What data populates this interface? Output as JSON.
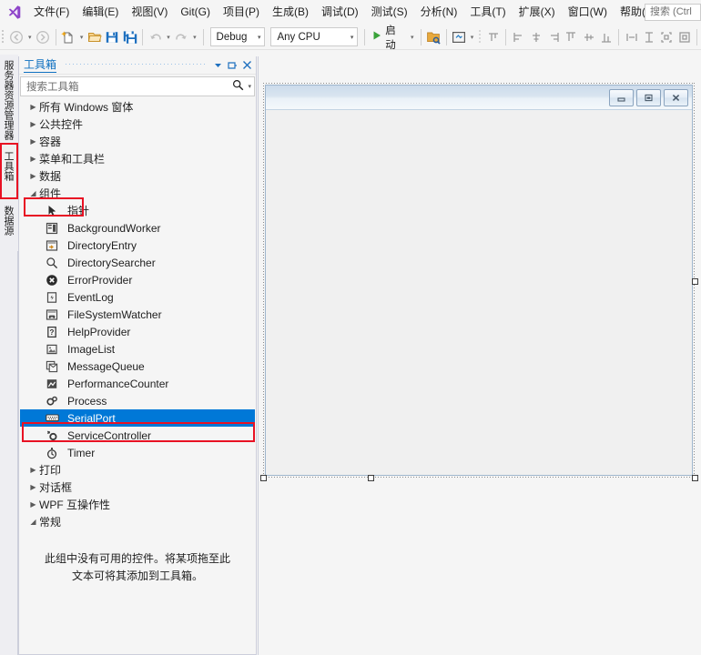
{
  "app": {
    "logo_icon": "visual-studio-logo",
    "menu": [
      {
        "label": "文件(F)",
        "name": "menu-file"
      },
      {
        "label": "编辑(E)",
        "name": "menu-edit"
      },
      {
        "label": "视图(V)",
        "name": "menu-view"
      },
      {
        "label": "Git(G)",
        "name": "menu-git"
      },
      {
        "label": "项目(P)",
        "name": "menu-project"
      },
      {
        "label": "生成(B)",
        "name": "menu-build"
      },
      {
        "label": "调试(D)",
        "name": "menu-debug"
      },
      {
        "label": "测试(S)",
        "name": "menu-test"
      },
      {
        "label": "分析(N)",
        "name": "menu-analyze"
      },
      {
        "label": "工具(T)",
        "name": "menu-tools"
      },
      {
        "label": "扩展(X)",
        "name": "menu-extensions"
      },
      {
        "label": "窗口(W)",
        "name": "menu-window"
      },
      {
        "label": "帮助(H)",
        "name": "menu-help"
      }
    ],
    "search": {
      "placeholder": "搜索 (Ctrl",
      "value": ""
    }
  },
  "toolbar": {
    "nav_back_icon": "back-arrow-icon",
    "nav_forward_icon": "forward-arrow-icon",
    "new_file_icon": "new-file-icon",
    "open_file_icon": "open-folder-icon",
    "save_icon": "save-icon",
    "save_all_icon": "save-all-icon",
    "undo_icon": "undo-icon",
    "redo_icon": "redo-icon",
    "configuration": {
      "value": "Debug",
      "caret": "▾"
    },
    "platform": {
      "value": "Any CPU",
      "caret": "▾"
    },
    "run": {
      "label": "启动",
      "play_icon": "play-triangle-icon",
      "caret": "▾"
    },
    "align_icons": [
      "find-in-files-icon",
      "preview-icon",
      "dropdown-small-icon",
      "align-tops-icon",
      "align-lefts-icon",
      "align-centers-icon",
      "align-rights-icon",
      "align-top-edges-icon",
      "align-middles-icon",
      "align-bottoms-icon",
      "make-same-width-icon",
      "make-same-height-icon",
      "size-to-grid-icon",
      "center-horizontally-icon"
    ]
  },
  "vertical_tabs": [
    {
      "label": "服务器资源管理器",
      "name": "vtab-server-explorer",
      "active": false,
      "highlighted": false
    },
    {
      "label": "工具箱",
      "name": "vtab-toolbox",
      "active": true,
      "highlighted": true
    },
    {
      "label": "数据源",
      "name": "vtab-data-sources",
      "active": false,
      "highlighted": false
    }
  ],
  "toolbox": {
    "title": "工具箱",
    "dropdown_icon": "chevron-down-icon",
    "pin_icon": "pin-icon",
    "close_icon": "close-icon",
    "search": {
      "placeholder": "搜索工具箱",
      "value": "",
      "icon": "search-icon",
      "caret": "▾"
    },
    "groups": [
      {
        "label": "所有 Windows 窗体",
        "expanded": false,
        "name": "toolbox-group-all-windows-forms"
      },
      {
        "label": "公共控件",
        "expanded": false,
        "name": "toolbox-group-common-controls"
      },
      {
        "label": "容器",
        "expanded": false,
        "name": "toolbox-group-containers"
      },
      {
        "label": "菜单和工具栏",
        "expanded": false,
        "name": "toolbox-group-menus-toolbars"
      },
      {
        "label": "数据",
        "expanded": false,
        "name": "toolbox-group-data"
      },
      {
        "label": "组件",
        "expanded": true,
        "name": "toolbox-group-components",
        "highlighted": true
      }
    ],
    "components": [
      {
        "label": "指针",
        "icon": "pointer-icon",
        "selected": false
      },
      {
        "label": "BackgroundWorker",
        "icon": "background-worker-icon",
        "selected": false
      },
      {
        "label": "DirectoryEntry",
        "icon": "directory-entry-icon",
        "selected": false
      },
      {
        "label": "DirectorySearcher",
        "icon": "directory-searcher-icon",
        "selected": false
      },
      {
        "label": "ErrorProvider",
        "icon": "error-provider-icon",
        "selected": false
      },
      {
        "label": "EventLog",
        "icon": "event-log-icon",
        "selected": false
      },
      {
        "label": "FileSystemWatcher",
        "icon": "file-system-watcher-icon",
        "selected": false
      },
      {
        "label": "HelpProvider",
        "icon": "help-provider-icon",
        "selected": false
      },
      {
        "label": "ImageList",
        "icon": "image-list-icon",
        "selected": false
      },
      {
        "label": "MessageQueue",
        "icon": "message-queue-icon",
        "selected": false
      },
      {
        "label": "PerformanceCounter",
        "icon": "performance-counter-icon",
        "selected": false
      },
      {
        "label": "Process",
        "icon": "process-icon",
        "selected": false
      },
      {
        "label": "SerialPort",
        "icon": "serial-port-icon",
        "selected": true,
        "highlighted": true
      },
      {
        "label": "ServiceController",
        "icon": "service-controller-icon",
        "selected": false
      },
      {
        "label": "Timer",
        "icon": "timer-icon",
        "selected": false
      }
    ],
    "trailing_groups": [
      {
        "label": "打印",
        "expanded": false,
        "name": "toolbox-group-printing"
      },
      {
        "label": "对话框",
        "expanded": false,
        "name": "toolbox-group-dialogs"
      },
      {
        "label": "WPF 互操作性",
        "expanded": false,
        "name": "toolbox-group-wpf-interoperability"
      },
      {
        "label": "常规",
        "expanded": true,
        "name": "toolbox-group-general"
      }
    ],
    "empty_message": "此组中没有可用的控件。将某项拖至此文本可将其添加到工具箱。"
  },
  "designer": {
    "window_buttons": [
      {
        "icon": "minimize-icon",
        "name": "form-minimize-button"
      },
      {
        "icon": "maximize-icon",
        "name": "form-maximize-button"
      },
      {
        "icon": "close-icon",
        "name": "form-close-button"
      }
    ]
  },
  "colors": {
    "accent": "#0078d7",
    "annotation_red": "#e81123",
    "link_blue": "#0e70c0",
    "chrome_bg": "#f5f5f5",
    "panel_border": "#cccedb"
  }
}
